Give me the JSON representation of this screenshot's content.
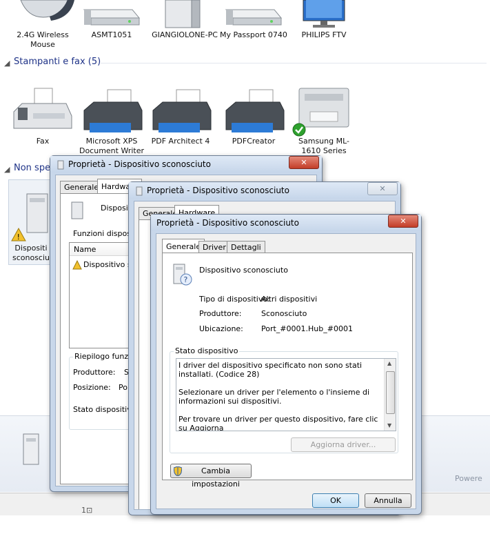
{
  "devices_row1": [
    {
      "label": "2.4G Wireless Mouse"
    },
    {
      "label": "ASMT1051"
    },
    {
      "label": "GIANGIOLONE-PC"
    },
    {
      "label": "My Passport 0740"
    },
    {
      "label": "PHILIPS FTV"
    }
  ],
  "printers_section": {
    "title": "Stampanti e fax (5)"
  },
  "printers": [
    {
      "label": "Fax"
    },
    {
      "label": "Microsoft XPS Document Writer"
    },
    {
      "label": "PDF Architect 4"
    },
    {
      "label": "PDFCreator"
    },
    {
      "label": "Samsung ML-1610 Series"
    }
  ],
  "unspecified_section": {
    "title": "Non spe"
  },
  "unspecified_device": {
    "label": "Dispositi sconosciu"
  },
  "status_bar": {
    "text": "Powere",
    "icon_text": "1⊡"
  },
  "dialog_back": {
    "title": "Proprietà - Dispositivo sconosciuto",
    "tabs": [
      "Generale",
      "Hardware"
    ],
    "device_name": "Dispositi",
    "functions_label": "Funzioni dispositiv",
    "list_header": "Name",
    "list_item": "Dispositivo sco",
    "summary_title": "Riepilogo funzion",
    "producer_label": "Produttore:",
    "producer_value": "S",
    "position_label": "Posizione:",
    "position_value": "Por",
    "status_label": "Stato dispositivo:",
    "close_label": "✕"
  },
  "dialog_mid": {
    "title": "Proprietà - Dispositivo sconosciuto",
    "tabs": [
      "Generale",
      "Hardware"
    ],
    "close_label": "✕"
  },
  "dialog_front": {
    "title": "Proprietà - Dispositivo sconosciuto",
    "tabs": [
      "Generale",
      "Driver",
      "Dettagli"
    ],
    "device_name": "Dispositivo sconosciuto",
    "type_label": "Tipo di dispositivo:",
    "type_value": "Altri dispositivi",
    "producer_label": "Produttore:",
    "producer_value": "Sconosciuto",
    "location_label": "Ubicazione:",
    "location_value": "Port_#0001.Hub_#0001",
    "status_group": "Stato dispositivo",
    "status_text": "I driver del dispositivo specificato non sono stati installati. (Codice 28)\n\nSelezionare un driver per l'elemento o l'insieme di informazioni sui dispositivi.\n\nPer trovare un driver per questo dispositivo, fare clic su Aggiorna",
    "update_driver": "Aggiorna driver...",
    "change_settings": "Cambia impostazioni",
    "ok": "OK",
    "cancel": "Annulla",
    "close_label": "✕"
  }
}
